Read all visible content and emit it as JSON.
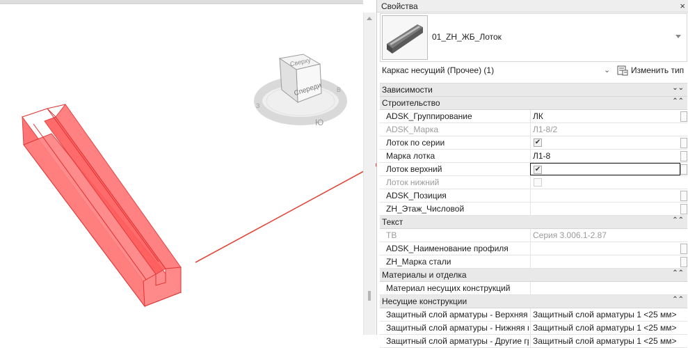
{
  "colors": {
    "model_fill": "#ff7070",
    "model_edge": "#e03030",
    "arrow": "#e14a3c"
  },
  "viewcube": {
    "top_label": "Сверху",
    "front_label": "Спереди",
    "compass": [
      "Ю",
      "З",
      "В"
    ]
  },
  "panel": {
    "title": "Свойства",
    "close_icon": "close-icon",
    "type_name": "01_ZH_ЖБ_Лоток",
    "instance_filter": "Каркас несущий (Прочее) (1)",
    "edit_type_label": "Изменить тип",
    "groups": {
      "dependencies": {
        "label": "Зависимости",
        "toggle": "»"
      },
      "construction": {
        "label": "Строительство",
        "toggle": "«",
        "rows": [
          {
            "name": "ADSK_Группирование",
            "value": "ЛК"
          },
          {
            "name": "ADSK_Марка",
            "value": "Л1-8/2"
          },
          {
            "name": "Лоток по серии",
            "value": "",
            "checked": true
          },
          {
            "name": "Марка лотка",
            "value": "Л1-8"
          },
          {
            "name": "Лоток верхний",
            "value": "",
            "checked": true
          },
          {
            "name": "Лоток нижний",
            "value": "",
            "checked": false
          },
          {
            "name": "ADSK_Позиция",
            "value": ""
          },
          {
            "name": "ZH_Этаж_Числовой",
            "value": ""
          }
        ]
      },
      "text": {
        "label": "Текст",
        "toggle": "«",
        "rows": [
          {
            "name": "ТВ",
            "value": "Серия 3.006.1-2.87"
          },
          {
            "name": "ADSK_Наименование профиля",
            "value": ""
          },
          {
            "name": "ZH_Марка стали",
            "value": ""
          }
        ]
      },
      "materials": {
        "label": "Материалы и отделка",
        "toggle": "«",
        "rows": [
          {
            "name": "Материал несущих конструкций",
            "value": ""
          }
        ]
      },
      "structural": {
        "label": "Несущие конструкции",
        "toggle": "«",
        "rows": [
          {
            "name": "Защитный слой арматуры - Верхняя грань",
            "value": "Защитный слой арматуры 1 <25 мм>"
          },
          {
            "name": "Защитный слой арматуры - Нижняя грань",
            "value": "Защитный слой арматуры 1 <25 мм>"
          },
          {
            "name": "Защитный слой арматуры - Другие грани",
            "value": "Защитный слой арматуры 1 <25 мм>"
          }
        ]
      }
    }
  }
}
